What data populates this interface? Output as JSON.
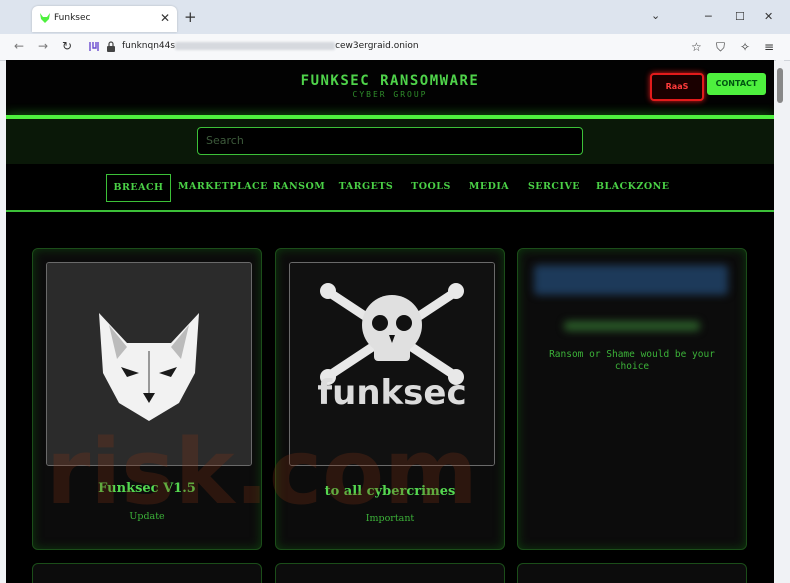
{
  "browser": {
    "tab_title": "Funksec",
    "tab_close": "✕",
    "new_tab": "+",
    "tab_list_icon": "chevron-down-icon",
    "url_prefix": "funknqn44s",
    "url_suffix": "cew3ergraid.onion",
    "window_controls": [
      "─",
      "☐",
      "✕"
    ],
    "nav_icons": [
      "←",
      "→",
      "↻"
    ],
    "toolbar_icons": [
      "☆",
      "⛉",
      "✧",
      "≡"
    ]
  },
  "site": {
    "title": "FUNKSEC RANSOMWARE",
    "subtitle": "CYBER GROUP",
    "raas_label": "RaaS",
    "contact_label": "CONTACT",
    "search_placeholder": "Search",
    "menu": [
      {
        "label": "BREACH",
        "active": true
      },
      {
        "label": "MARKETPLACE",
        "active": false
      },
      {
        "label": "RANSOM",
        "active": false
      },
      {
        "label": "TARGETS",
        "active": false
      },
      {
        "label": "TOOLS",
        "active": false
      },
      {
        "label": "MEDIA",
        "active": false
      },
      {
        "label": "SERCIVE",
        "active": false
      },
      {
        "label": "BLACKZONE",
        "active": false
      }
    ]
  },
  "cards": [
    {
      "title": "Funksec V1.5",
      "subtitle": "Update"
    },
    {
      "title": "to all cybercrimes",
      "subtitle": "Important",
      "image_text": "funksec"
    },
    {
      "text": "Ransom or Shame would be your choice"
    }
  ],
  "watermark": "risk.com",
  "colors": {
    "accent": "#4ef03e",
    "raas": "#e21b1b",
    "background": "#000000"
  }
}
